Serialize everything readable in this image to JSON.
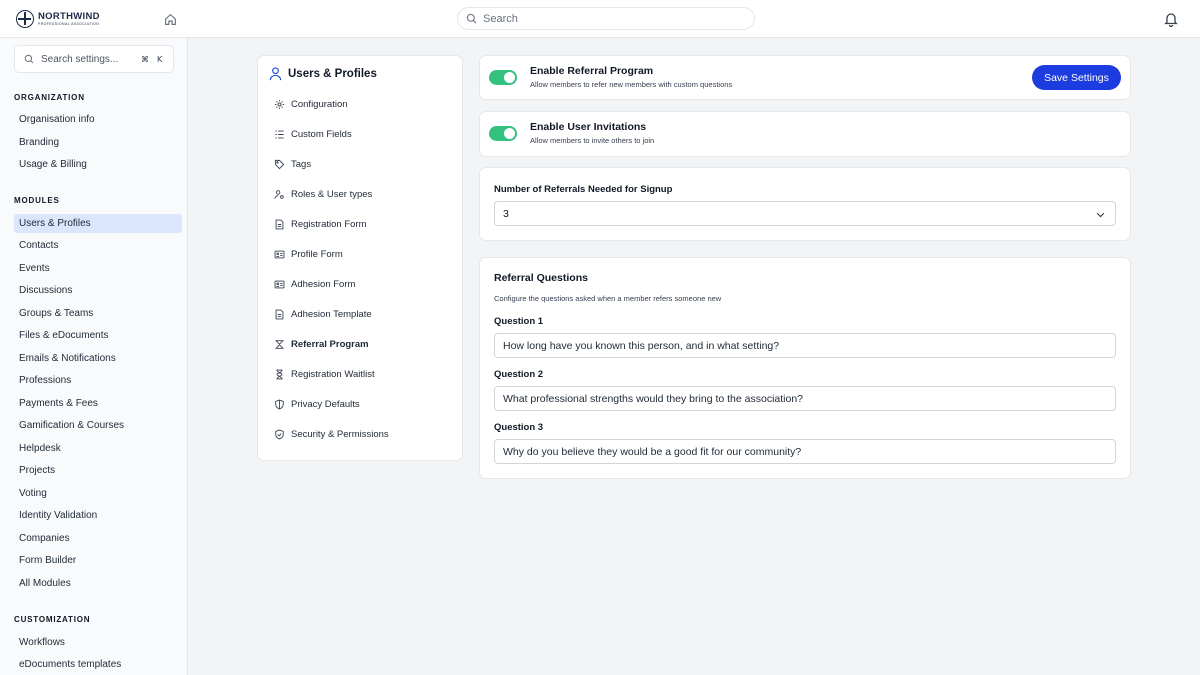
{
  "brand": {
    "name": "NORTHWIND",
    "tagline": "PROFESSIONAL ASSOCIATION"
  },
  "topbar": {
    "search_placeholder": "Search"
  },
  "sidebar": {
    "search_placeholder": "Search settings...",
    "shortcut": [
      "⌘",
      "K"
    ],
    "sections": [
      {
        "title": "ORGANIZATION",
        "items": [
          "Organisation info",
          "Branding",
          "Usage & Billing"
        ]
      },
      {
        "title": "MODULES",
        "items": [
          "Users & Profiles",
          "Contacts",
          "Events",
          "Discussions",
          "Groups & Teams",
          "Files & eDocuments",
          "Emails & Notifications",
          "Professions",
          "Payments & Fees",
          "Gamification & Courses",
          "Helpdesk",
          "Projects",
          "Voting",
          "Identity Validation",
          "Companies",
          "Form Builder",
          "All Modules"
        ]
      },
      {
        "title": "CUSTOMIZATION",
        "items": [
          "Workflows",
          "eDocuments templates"
        ]
      }
    ],
    "active_item": "Users & Profiles"
  },
  "submenu": {
    "title": "Users & Profiles",
    "items": [
      {
        "label": "Configuration",
        "icon": "gear-icon"
      },
      {
        "label": "Custom Fields",
        "icon": "list-icon"
      },
      {
        "label": "Tags",
        "icon": "tag-icon"
      },
      {
        "label": "Roles & User types",
        "icon": "user-roles-icon"
      },
      {
        "label": "Registration Form",
        "icon": "document-icon"
      },
      {
        "label": "Profile Form",
        "icon": "id-card-icon"
      },
      {
        "label": "Adhesion Form",
        "icon": "id-card-icon"
      },
      {
        "label": "Adhesion Template",
        "icon": "document-icon"
      },
      {
        "label": "Referral Program",
        "icon": "referral-icon"
      },
      {
        "label": "Registration Waitlist",
        "icon": "hourglass-icon"
      },
      {
        "label": "Privacy Defaults",
        "icon": "shield-icon"
      },
      {
        "label": "Security & Permissions",
        "icon": "shield-check-icon"
      }
    ],
    "active_item": "Referral Program"
  },
  "settings": {
    "referral_toggle": {
      "title": "Enable Referral Program",
      "description": "Allow members to refer new members with custom questions",
      "enabled": true
    },
    "invite_toggle": {
      "title": "Enable User Invitations",
      "description": "Allow members to invite others to join",
      "enabled": true
    },
    "save_label": "Save Settings",
    "referrals_needed": {
      "label": "Number of Referrals Needed for Signup",
      "value": "3"
    },
    "questions": {
      "title": "Referral Questions",
      "description": "Configure the questions asked when a member refers someone new",
      "items": [
        {
          "label": "Question 1",
          "value": "How long have you known this person, and in what setting?"
        },
        {
          "label": "Question 2",
          "value": "What professional strengths would they bring to the association?"
        },
        {
          "label": "Question 3",
          "value": "Why do you believe they would be a good fit for our community?"
        }
      ]
    }
  },
  "colors": {
    "accent": "#1d3cdf",
    "toggle_on": "#34c17f",
    "active_nav": "#dbe5fb"
  }
}
